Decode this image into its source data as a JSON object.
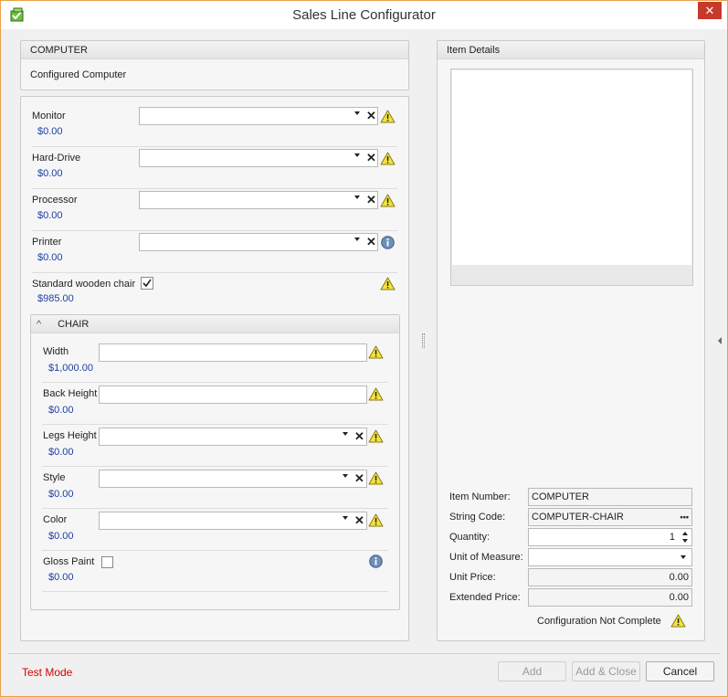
{
  "window": {
    "title": "Sales Line Configurator",
    "close_glyph": "✕"
  },
  "product": {
    "header": "COMPUTER",
    "name": "Configured Computer"
  },
  "options": [
    {
      "label": "Monitor",
      "price": "$0.00",
      "status": "warning"
    },
    {
      "label": "Hard-Drive",
      "price": "$0.00",
      "status": "warning"
    },
    {
      "label": "Processor",
      "price": "$0.00",
      "status": "warning"
    },
    {
      "label": "Printer",
      "price": "$0.00",
      "status": "info"
    },
    {
      "label": "Standard wooden chair",
      "price": "$985.00",
      "checked": true,
      "status": "warning"
    }
  ],
  "chair_group": {
    "header": "CHAIR",
    "collapse_glyph": "^",
    "fields": [
      {
        "label": "Width",
        "price": "$1,000.00"
      },
      {
        "label": "Back Height",
        "price": "$0.00"
      },
      {
        "label": "Legs Height",
        "price": "$0.00"
      },
      {
        "label": "Style",
        "price": "$0.00"
      },
      {
        "label": "Color",
        "price": "$0.00"
      },
      {
        "label": "Gloss Paint",
        "price": "$0.00"
      }
    ]
  },
  "item_details": {
    "header": "Item Details",
    "item_number_label": "Item Number:",
    "item_number": "COMPUTER",
    "string_code_label": "String Code:",
    "string_code": "COMPUTER-CHAIR",
    "string_code_button": "•••",
    "quantity_label": "Quantity:",
    "quantity": "1",
    "uom_label": "Unit of Measure:",
    "uom": "",
    "unit_price_label": "Unit Price:",
    "unit_price": "0.00",
    "extended_price_label": "Extended Price:",
    "extended_price": "0.00",
    "status_text": "Configuration Not Complete"
  },
  "footer": {
    "mode_text": "Test Mode",
    "add_label": "Add",
    "add_close_label": "Add & Close",
    "cancel_label": "Cancel"
  },
  "colors": {
    "accent_border": "#e8a04d",
    "price_text": "#1d3fa3",
    "test_mode": "#d40000",
    "close_button": "#c7392b"
  }
}
